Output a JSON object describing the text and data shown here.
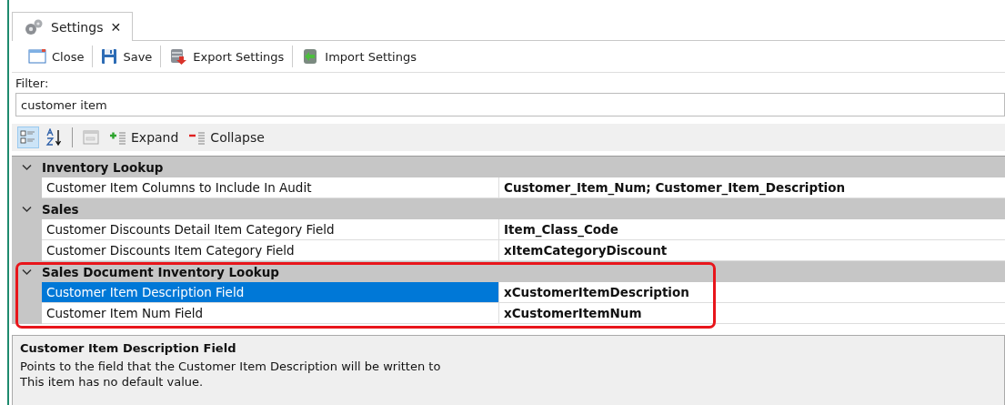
{
  "tab": {
    "label": "Settings",
    "close": "✕",
    "selected": true
  },
  "toolbar": [
    {
      "label": "Close"
    },
    {
      "label": "Save"
    },
    {
      "label": "Export Settings"
    },
    {
      "label": "Import Settings"
    }
  ],
  "filter": {
    "label": "Filter:",
    "value": "customer item"
  },
  "grid_toolbar": {
    "categorized_selected": true,
    "alphabetical_selected": false,
    "expand": "Expand",
    "collapse": "Collapse"
  },
  "groups": [
    {
      "name": "Inventory Lookup",
      "expanded": true,
      "highlighted": false,
      "rows": [
        {
          "name": "Customer Item Columns to Include In Audit",
          "value": "Customer_Item_Num; Customer_Item_Description",
          "selected": false
        }
      ]
    },
    {
      "name": "Sales",
      "expanded": true,
      "highlighted": false,
      "rows": [
        {
          "name": "Customer Discounts Detail Item Category Field",
          "value": "Item_Class_Code",
          "selected": false
        },
        {
          "name": "Customer Discounts Item Category Field",
          "value": "xItemCategoryDiscount",
          "selected": false
        }
      ]
    },
    {
      "name": "Sales Document Inventory Lookup",
      "expanded": true,
      "highlighted": true,
      "rows": [
        {
          "name": "Customer Item Description Field",
          "value": "xCustomerItemDescription",
          "selected": true
        },
        {
          "name": "Customer Item Num Field",
          "value": "xCustomerItemNum",
          "selected": false
        }
      ]
    }
  ],
  "description": {
    "title": "Customer Item Description Field",
    "text": "Points to the field that the Customer Item Description will be written to",
    "default_note": "This item has no default value."
  }
}
